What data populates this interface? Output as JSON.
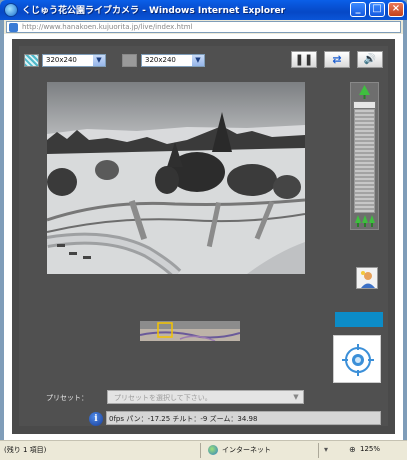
{
  "window": {
    "title": "くじゅう花公園ライブカメラ - Windows Internet Explorer",
    "minimize": "_",
    "maximize": "□",
    "close": "×"
  },
  "address": {
    "url": "http://www.hanakoen.kujuorita.jp/live/index.html"
  },
  "controls": {
    "resolution_1": "320x240",
    "resolution_2": "320x240",
    "pause_glyph": "❚❚",
    "swap_glyph": "⇄",
    "speaker_glyph": "🔊"
  },
  "preset": {
    "label": "プリセット：",
    "placeholder": "プリセットを選択して下さい。"
  },
  "status_info": {
    "text": "0fps パン：-17.25 チルト：-9 ズーム：34.98"
  },
  "statusbar": {
    "left_text": "(残り 1 項目)",
    "zone": "インターネット",
    "zoom": "125%"
  },
  "colors": {
    "panel_bg": "#505050",
    "accent_blue": "#0c8cc7",
    "xp_title": "#0648c6"
  }
}
